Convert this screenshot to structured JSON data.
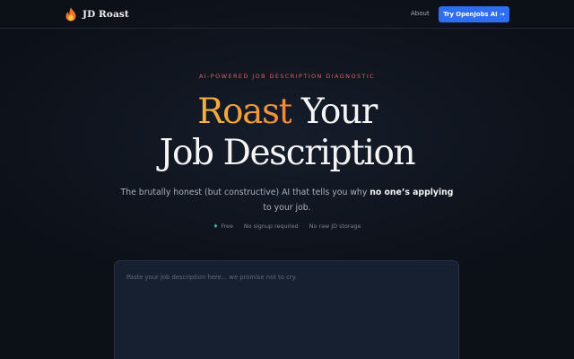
{
  "nav": {
    "brand_icon": "flame-icon",
    "brand_name": "JD Roast",
    "about_label": "About",
    "cta_label": "Try OpenJobs AI →",
    "cta_color": "#2f6ef2"
  },
  "hero": {
    "eyebrow": "AI-POWERED JOB DESCRIPTION DIAGNOSTIC",
    "headline_accent": "Roast",
    "headline_rest_1": " Your",
    "headline_line_2": "Job Description",
    "accent_colors": [
      "#f5b43a",
      "#f1883b"
    ],
    "subhead_lead": "The brutally honest (but constructive) AI that tells you why ",
    "subhead_emphasis": "no one’s applying",
    "subhead_tail": "to your job.",
    "features": [
      {
        "icon": "check-dot-icon",
        "label": "Free"
      },
      {
        "icon": "",
        "label": "No signup required"
      },
      {
        "icon": "",
        "label": "No raw JD storage"
      }
    ]
  },
  "jd_input": {
    "placeholder": "Paste your job description here... we promise not to cry.",
    "value": ""
  }
}
